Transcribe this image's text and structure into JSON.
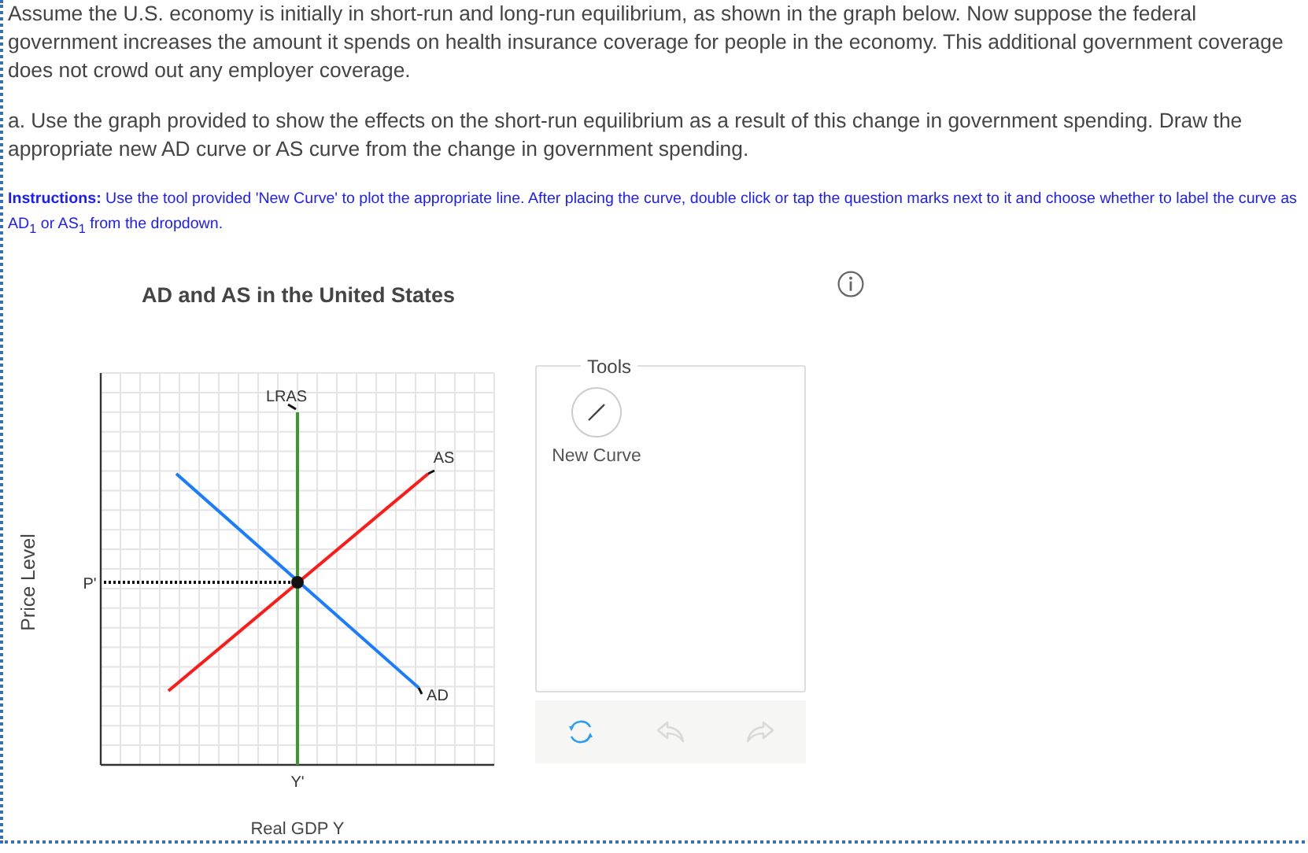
{
  "question": {
    "intro": "Assume the U.S. economy is initially in short-run and long-run equilibrium, as shown in the graph below. Now suppose the federal government increases the amount it spends on health insurance coverage for people in the economy. This additional government coverage does not crowd out any employer coverage.",
    "part_a": "a. Use the graph provided to show the effects on the short-run equilibrium as a result of this change in government spending. Draw the appropriate new AD curve or AS curve from the change in government spending.",
    "instructions": "**Instructions:** Use the tool provided 'New Curve' to plot the appropriate line. After placing the curve, double click or tap the question marks next to it and choose whether to label the curve as AD$_{1}$ or AS$_{1}$ from the dropdown."
  },
  "graph": {
    "title": "AD and AS in the United States",
    "y_axis_label": "Price Level",
    "x_axis_label": "Real GDP Y",
    "price_label": "P'",
    "output_label": "Y'",
    "curves": [
      {
        "label": "LRAS",
        "kind": "vertical",
        "color": "#3c9a2c"
      },
      {
        "label": "AS",
        "kind": "upward",
        "color": "#ff1a1a"
      },
      {
        "label": "AD",
        "kind": "downward",
        "color": "#1a7cff"
      }
    ]
  },
  "tools": {
    "legend": "Tools",
    "items": [
      {
        "label": "New Curve"
      }
    ],
    "actions": [
      {
        "kind": "reset",
        "disabled": false
      },
      {
        "kind": "undo",
        "disabled": true
      },
      {
        "kind": "redo",
        "disabled": true
      }
    ]
  }
}
